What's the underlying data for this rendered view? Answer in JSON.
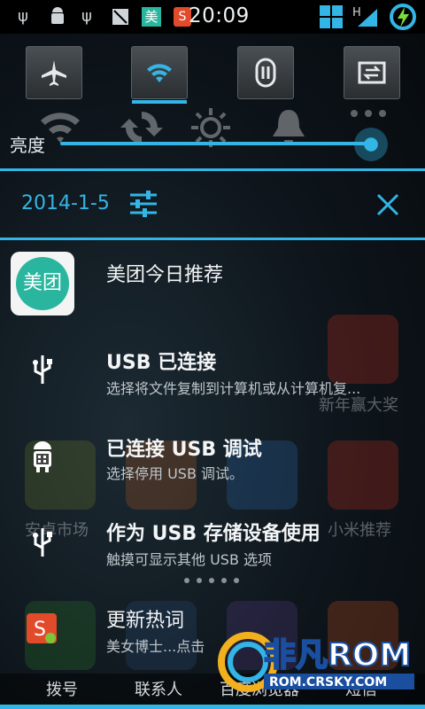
{
  "status_bar": {
    "time": "20:09",
    "network_label": "H",
    "meituan_glyph": "美",
    "sogou_glyph": "S",
    "icons": [
      "usb-icon",
      "android-debug-icon",
      "usb-icon",
      "no-notification-icon",
      "meituan-icon",
      "sogou-icon",
      "windows-icon",
      "signal-icon",
      "battery-charging-icon"
    ]
  },
  "quick_settings": {
    "toggles": [
      {
        "name": "airplane-mode",
        "icon": "airplane-icon",
        "active": false
      },
      {
        "name": "wifi",
        "icon": "wifi-icon",
        "active": true
      },
      {
        "name": "data",
        "icon": "data-icon",
        "active": false
      },
      {
        "name": "rotate",
        "icon": "rotate-icon",
        "active": false
      }
    ],
    "secondary": [
      "wifi-icon",
      "sync-icon",
      "brightness-icon",
      "bell-icon",
      "more-icon"
    ]
  },
  "brightness": {
    "label": "亮度",
    "level": 0.97
  },
  "header": {
    "date": "2014-1-5"
  },
  "notifications": [
    {
      "title": "美团今日推荐",
      "subtitle": "",
      "icon": "meituan-app-icon",
      "icon_text": "美团"
    },
    {
      "title": "USB 已连接",
      "subtitle": "选择将文件复制到计算机或从计算机复...",
      "icon": "usb-icon"
    },
    {
      "title": "已连接 USB 调试",
      "subtitle": "选择停用 USB 调试。",
      "icon": "android-debug-icon"
    },
    {
      "title": "作为 USB 存储设备使用",
      "subtitle": "触摸可显示其他 USB 选项",
      "icon": "usb-icon"
    },
    {
      "title": "更新热词",
      "subtitle": "美女博士...点击",
      "icon": "sogou-icon"
    }
  ],
  "background_labels": {
    "app_market": "安卓市场",
    "xiaomi": "小米推荐",
    "new_year": "新年赢大奖",
    "dial": "拨号",
    "contacts": "联系人",
    "browser": "百度浏览器",
    "sms": "短信"
  },
  "watermark": {
    "brand": "非凡ROM",
    "url": "ROM.CRSKY.COM"
  },
  "colors": {
    "accent": "#33b5e5",
    "meituan": "#2ab69e"
  }
}
